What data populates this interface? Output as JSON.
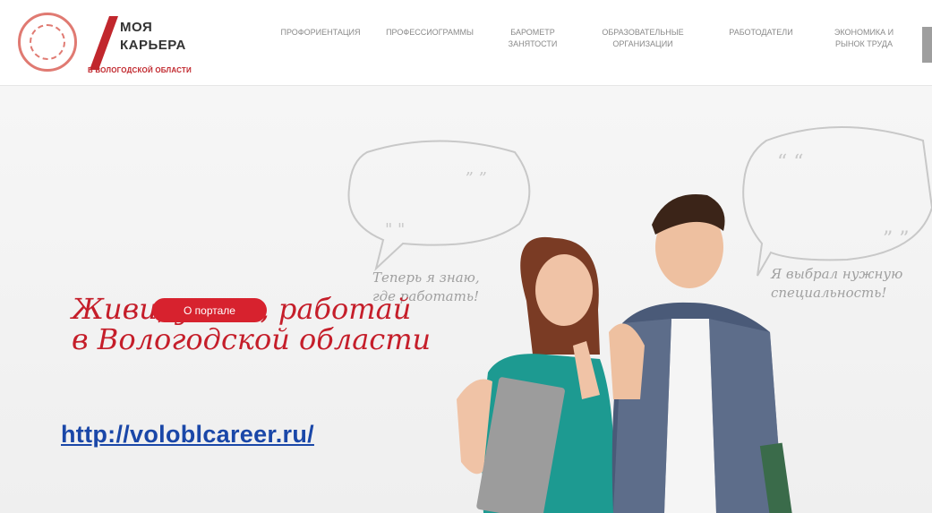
{
  "logo": {
    "line1": "МОЯ",
    "line2": "КАРЬЕРА",
    "subtitle": "В ВОЛОГОДСКОЙ ОБЛАСТИ"
  },
  "nav": {
    "items": [
      [
        "ПРОФОРИЕНТАЦИЯ"
      ],
      [
        "ПРОФЕССИОГРАММЫ"
      ],
      [
        "БАРОМЕТР",
        "ЗАНЯТОСТИ"
      ],
      [
        "ОБРАЗОВАТЕЛЬНЫЕ",
        "ОРГАНИЗАЦИИ"
      ],
      [
        "РАБОТОДАТЕЛИ"
      ],
      [
        "ЭКОНОМИКА И",
        "РЫНОК ТРУДА"
      ]
    ]
  },
  "hero": {
    "slogan_line1": "Живи, учись, работай",
    "slogan_line2": "в Вологодской области",
    "about_button": "О портале",
    "bubble_left_line1": "Теперь я знаю,",
    "bubble_left_line2": "где работать!",
    "bubble_right_line1": "Я выбрал нужную",
    "bubble_right_line2": "специальность!"
  },
  "url": "http://voloblcareer.ru/",
  "colors": {
    "brand_red": "#d7222e",
    "link_blue": "#1a47a8",
    "nav_gray": "#8a8a8a"
  }
}
